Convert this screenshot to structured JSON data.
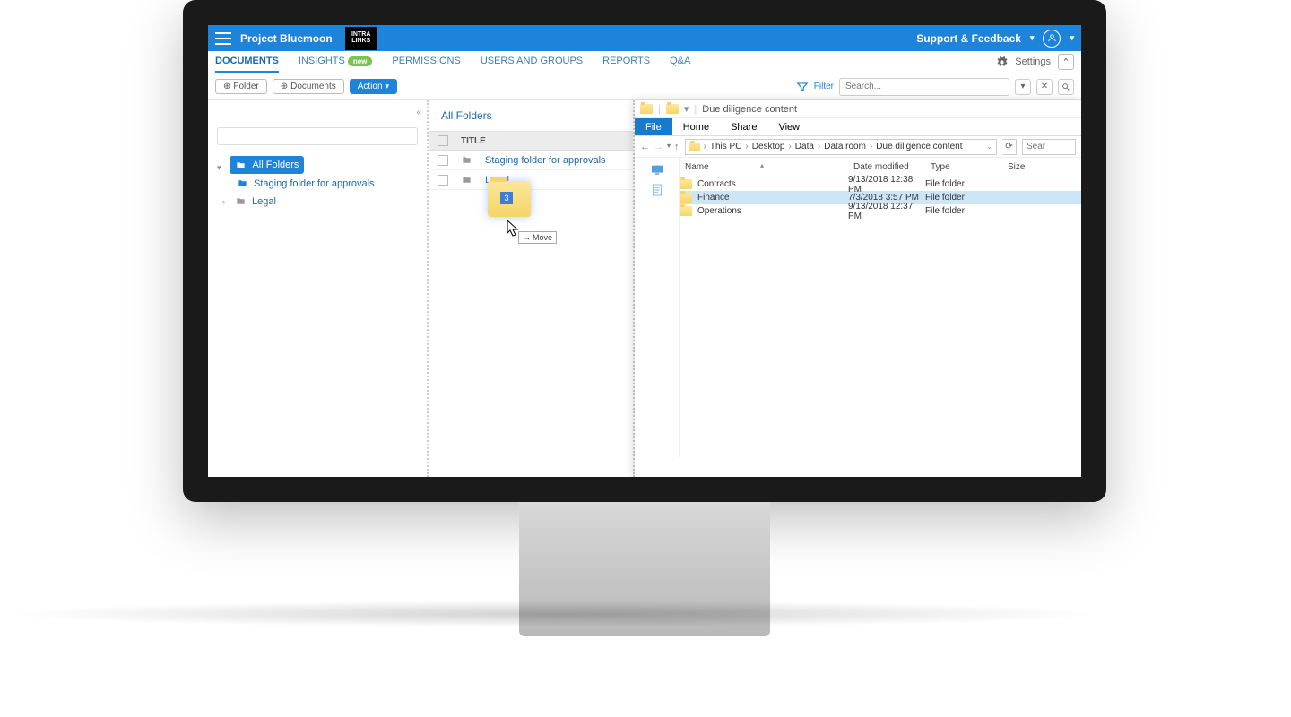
{
  "header": {
    "project": "Project Bluemoon",
    "brand_line1": "INTRA",
    "brand_line2": "LINKS",
    "support": "Support & Feedback"
  },
  "tabs": {
    "documents": "DOCUMENTS",
    "insights": "INSIGHTS",
    "new": "new",
    "permissions": "PERMISSIONS",
    "users": "USERS AND GROUPS",
    "reports": "REPORTS",
    "qa": "Q&A",
    "settings": "Settings"
  },
  "toolbar": {
    "folder_btn": "Folder",
    "documents_btn": "Documents",
    "action_btn": "Action",
    "filter": "Filter",
    "search_ph": "Search..."
  },
  "tree": {
    "root": "All Folders",
    "items": [
      "Staging folder for approvals",
      "Legal"
    ]
  },
  "list": {
    "title": "All Folders",
    "col_title": "TITLE",
    "rows": [
      "Staging folder for approvals",
      "Legal"
    ]
  },
  "drag": {
    "count": "3",
    "tooltip": "Move"
  },
  "explorer": {
    "window_title": "Due diligence content",
    "ribbon": {
      "file": "File",
      "home": "Home",
      "share": "Share",
      "view": "View"
    },
    "breadcrumb": [
      "This PC",
      "Desktop",
      "Data",
      "Data room",
      "Due diligence content"
    ],
    "addr_dropdown": "v",
    "search_ph": "Sear",
    "cols": {
      "name": "Name",
      "date": "Date modified",
      "type": "Type",
      "size": "Size"
    },
    "rows": [
      {
        "name": "Contracts",
        "date": "9/13/2018 12:38 PM",
        "type": "File folder"
      },
      {
        "name": "Finance",
        "date": "7/3/2018 3:57 PM",
        "type": "File folder"
      },
      {
        "name": "Operations",
        "date": "9/13/2018 12:37 PM",
        "type": "File folder"
      }
    ]
  }
}
